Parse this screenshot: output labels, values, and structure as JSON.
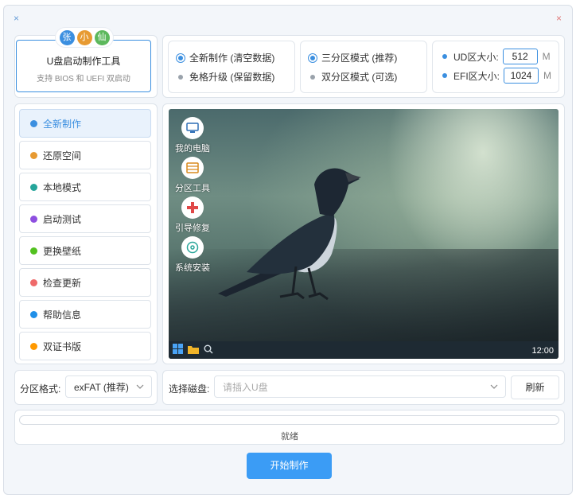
{
  "titlebar": {
    "left_close": "×",
    "right_close": "×"
  },
  "logo": {
    "badges": [
      {
        "text": "张",
        "color": "#3b8fe0"
      },
      {
        "text": "小",
        "color": "#e79a32"
      },
      {
        "text": "仙",
        "color": "#5cb85c"
      }
    ],
    "title": "U盘启动制作工具",
    "subtitle": "支持 BIOS 和 UEFI 双启动"
  },
  "make_mode": {
    "options": [
      {
        "label": "全新制作 (清空数据)",
        "selected": true
      },
      {
        "label": "免格升级 (保留数据)",
        "selected": false
      }
    ]
  },
  "partition_mode": {
    "options": [
      {
        "label": "三分区模式 (推荐)",
        "selected": true
      },
      {
        "label": "双分区模式 (可选)",
        "selected": false
      }
    ]
  },
  "sizes": {
    "ud": {
      "label": "UD区大小:",
      "value": "512",
      "unit": "M"
    },
    "efi": {
      "label": "EFI区大小:",
      "value": "1024",
      "unit": "M"
    }
  },
  "sidebar": {
    "items": [
      {
        "label": "全新制作",
        "color": "#3b8fe0",
        "active": true
      },
      {
        "label": "还原空间",
        "color": "#e79a32",
        "active": false
      },
      {
        "label": "本地模式",
        "color": "#25a59a",
        "active": false
      },
      {
        "label": "启动测试",
        "color": "#8e4fe0",
        "active": false
      },
      {
        "label": "更换壁纸",
        "color": "#52c11f",
        "active": false
      },
      {
        "label": "检查更新",
        "color": "#ef6a6a",
        "active": false
      },
      {
        "label": "帮助信息",
        "color": "#1f8fe8",
        "active": false
      },
      {
        "label": "双证书版",
        "color": "#ff9900",
        "active": false
      }
    ]
  },
  "preview": {
    "desktop_icons": [
      {
        "label": "我的电脑",
        "icon": "computer-icon"
      },
      {
        "label": "分区工具",
        "icon": "partition-tool-icon"
      },
      {
        "label": "引导修复",
        "icon": "boot-repair-icon"
      },
      {
        "label": "系统安装",
        "icon": "disc-install-icon"
      }
    ],
    "clock": "12:00"
  },
  "format": {
    "label": "分区格式:",
    "value": "exFAT (推荐)"
  },
  "disk": {
    "label": "选择磁盘:",
    "placeholder": "请插入U盘"
  },
  "refresh_label": "刷新",
  "progress": {
    "value": 0
  },
  "status": "就绪",
  "start_label": "开始制作"
}
